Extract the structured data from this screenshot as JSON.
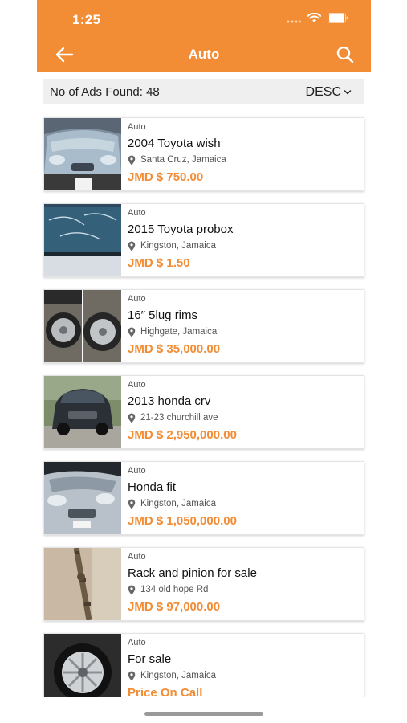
{
  "status_bar": {
    "time": "1:25"
  },
  "header": {
    "title": "Auto"
  },
  "summary": {
    "count_text": "No of Ads Found: 48",
    "sort_label": "DESC"
  },
  "ads": [
    {
      "category": "Auto",
      "title": "2004 Toyota wish",
      "location": "Santa Cruz, Jamaica",
      "price": "JMD $ 750.00"
    },
    {
      "category": "Auto",
      "title": "2015 Toyota probox",
      "location": "Kingston, Jamaica",
      "price": "JMD $ 1.50"
    },
    {
      "category": "Auto",
      "title": "16″ 5lug rims",
      "location": "Highgate, Jamaica",
      "price": "JMD $ 35,000.00"
    },
    {
      "category": "Auto",
      "title": "2013 honda crv",
      "location": "21-23 churchill ave",
      "price": "JMD $ 2,950,000.00"
    },
    {
      "category": "Auto",
      "title": "Honda fit",
      "location": "Kingston, Jamaica",
      "price": "JMD $ 1,050,000.00"
    },
    {
      "category": "Auto",
      "title": "Rack and pinion for sale",
      "location": "134 old hope Rd",
      "price": "JMD $ 97,000.00"
    },
    {
      "category": "Auto",
      "title": "For sale",
      "location": "Kingston, Jamaica",
      "price": "Price On Call"
    }
  ],
  "theme": {
    "accent": "#f28c35"
  },
  "icons": [
    "back-arrow-icon",
    "search-icon",
    "chevron-down-icon",
    "location-pin-icon",
    "wifi-icon",
    "battery-icon",
    "signal-icon"
  ]
}
